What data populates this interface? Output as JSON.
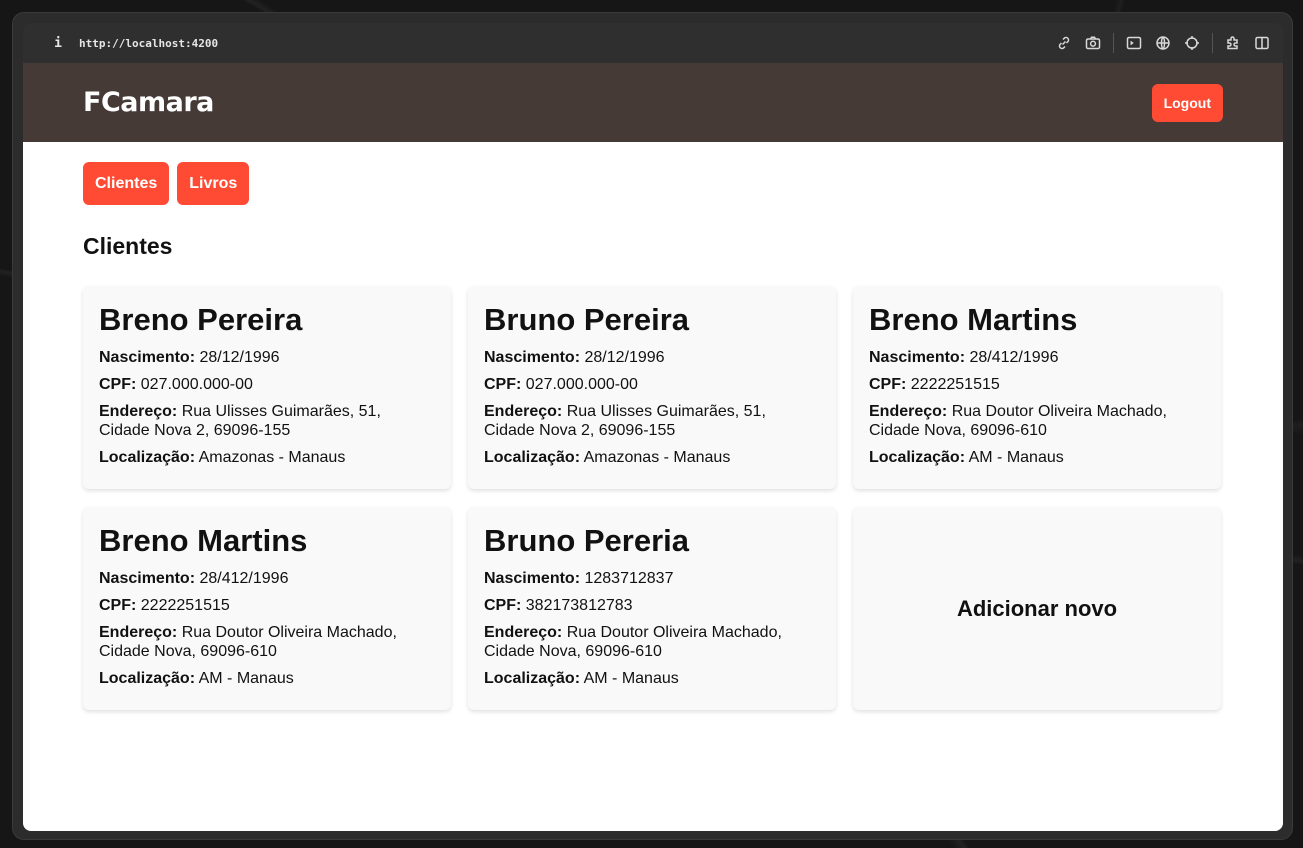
{
  "browser": {
    "url": "http://localhost:4200",
    "info_icon": "i"
  },
  "header": {
    "logo": "FCamara",
    "logout_label": "Logout"
  },
  "nav": {
    "clientes_label": "Clientes",
    "livros_label": "Livros"
  },
  "section": {
    "title": "Clientes"
  },
  "labels": {
    "nascimento": "Nascimento:",
    "cpf": "CPF:",
    "endereco": "Endereço:",
    "localizacao": "Localização:"
  },
  "clients": [
    {
      "name": "Breno Pereira",
      "nascimento": "28/12/1996",
      "cpf": "027.000.000-00",
      "endereco": "Rua Ulisses Guimarães, 51, Cidade Nova 2, 69096-155",
      "localizacao": "Amazonas - Manaus"
    },
    {
      "name": "Bruno Pereira",
      "nascimento": "28/12/1996",
      "cpf": "027.000.000-00",
      "endereco": "Rua Ulisses Guimarães, 51, Cidade Nova 2, 69096-155",
      "localizacao": "Amazonas - Manaus"
    },
    {
      "name": "Breno Martins",
      "nascimento": "28/412/1996",
      "cpf": "2222251515",
      "endereco": "Rua Doutor Oliveira Machado, Cidade Nova, 69096-610",
      "localizacao": "AM - Manaus"
    },
    {
      "name": "Breno Martins",
      "nascimento": "28/412/1996",
      "cpf": "2222251515",
      "endereco": "Rua Doutor Oliveira Machado, Cidade Nova, 69096-610",
      "localizacao": "AM - Manaus"
    },
    {
      "name": "Bruno Pereria",
      "nascimento": "1283712837",
      "cpf": "382173812783",
      "endereco": "Rua Doutor Oliveira Machado, Cidade Nova, 69096-610",
      "localizacao": "AM - Manaus"
    }
  ],
  "add_card": {
    "label": "Adicionar novo"
  },
  "colors": {
    "accent": "#ff4b33",
    "header_bg": "#463a37"
  },
  "icons": [
    "link-icon",
    "camera-icon",
    "terminal-icon",
    "globe-icon",
    "crosshair-icon",
    "extension-icon",
    "sidebar-icon"
  ]
}
